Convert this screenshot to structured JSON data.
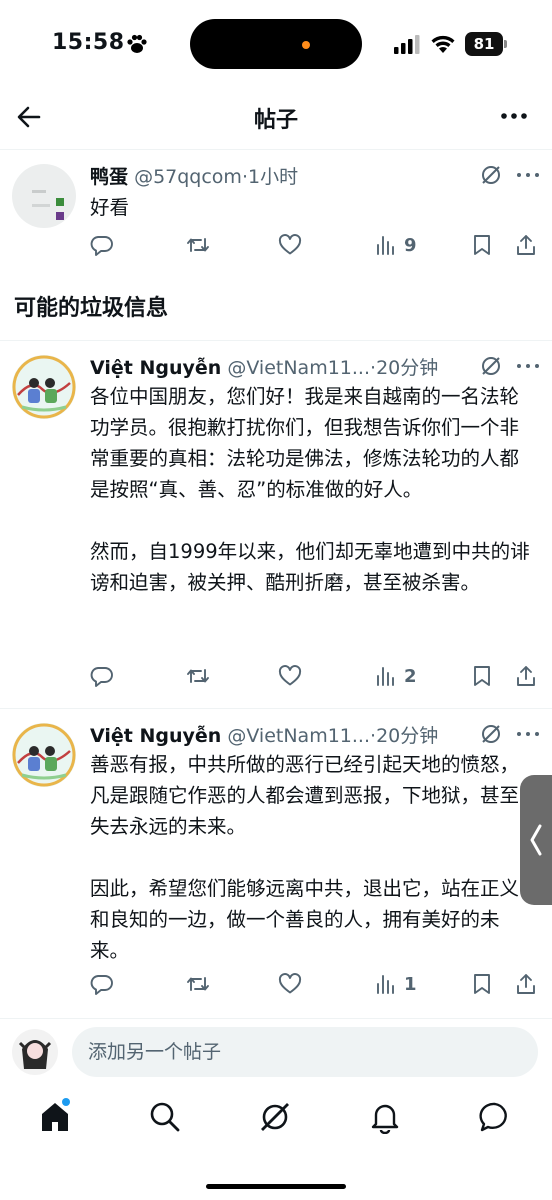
{
  "status_bar": {
    "time": "15:58",
    "battery": "81"
  },
  "header": {
    "title": "帖子"
  },
  "post1": {
    "name": "鸭蛋",
    "handle": "@57qqcom",
    "sep": "·",
    "time": "1小时",
    "text": "好看",
    "views": "9"
  },
  "section_title": "可能的垃圾信息",
  "post2": {
    "name": "Việt Nguyễn",
    "handle": "@VietNam11...",
    "sep": "·",
    "time": "20分钟",
    "para1": "各位中国朋友，您们好！我是来自越南的一名法轮功学员。很抱歉打扰你们，但我想告诉你们一个非常重要的真相：法轮功是佛法，修炼法轮功的人都是按照“真、善、忍”的标准做的好人。",
    "para2": "然而，自1999年以来，他们却无辜地遭到中共的诽谤和迫害，被关押、酷刑折磨，甚至被杀害。",
    "views": "2"
  },
  "post3": {
    "name": "Việt Nguyễn",
    "handle": "@VietNam11...",
    "sep": "·",
    "time": "20分钟",
    "para1": "善恶有报，中共所做的恶行已经引起天地的愤怒，凡是跟随它作恶的人都会遭到恶报，下地狱，甚至失去永远的未来。",
    "para2": "因此，希望您们能够远离中共，退出它，站在正义和良知的一边，做一个善良的人，拥有美好的未来。",
    "views": "1"
  },
  "reply": {
    "placeholder": "添加另一个帖子"
  },
  "colors": {
    "accent": "#1d9bf0",
    "text": "#0f1419",
    "secondary": "#536471",
    "divider": "#eff3f4"
  },
  "icons": {
    "header": [
      "back-arrow-icon",
      "more-icon"
    ],
    "actions": [
      "reply-icon",
      "retweet-icon",
      "like-icon",
      "views-icon",
      "bookmark-icon",
      "share-icon"
    ],
    "nav": [
      "home-icon",
      "search-icon",
      "grok-icon",
      "notifications-icon",
      "messages-icon"
    ]
  }
}
